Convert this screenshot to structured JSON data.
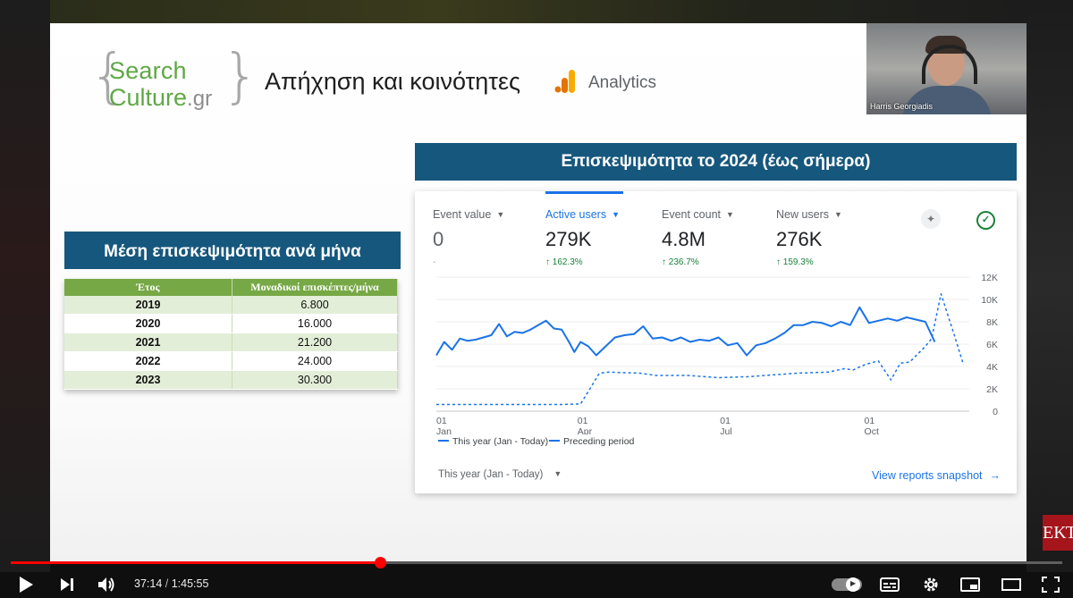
{
  "logo": {
    "line1": "Search",
    "line2": "Culture",
    "suffix": ".gr"
  },
  "slide": {
    "title": "Απήχηση και κοινότητες",
    "ga_label": "Analytics",
    "right_banner": "Επισκεψιμότητα το 2024 (έως σήμερα)",
    "left_banner": "Μέση επισκεψιμότητα ανά μήνα"
  },
  "webcam": {
    "name": "Harris Georgiadis"
  },
  "yearly_table": {
    "headers": [
      "Έτος",
      "Μοναδικοί επισκέπτες/μήνα"
    ],
    "rows": [
      {
        "year": "2019",
        "visitors": "6.800"
      },
      {
        "year": "2020",
        "visitors": "16.000"
      },
      {
        "year": "2021",
        "visitors": "21.200"
      },
      {
        "year": "2022",
        "visitors": "24.000"
      },
      {
        "year": "2023",
        "visitors": "30.300"
      }
    ]
  },
  "ga_card": {
    "metrics": [
      {
        "label": "Event value",
        "value": "0",
        "change": "-",
        "active": false
      },
      {
        "label": "Active users",
        "value": "279K",
        "change": "↑ 162.3%",
        "active": true
      },
      {
        "label": "Event count",
        "value": "4.8M",
        "change": "↑ 236.7%",
        "active": false
      },
      {
        "label": "New users",
        "value": "276K",
        "change": "↑ 159.3%",
        "active": false
      }
    ],
    "legend": {
      "current": "This year (Jan - Today)",
      "previous": "Preceding period"
    },
    "range_selector": "This year (Jan - Today)",
    "view_link": "View reports snapshot",
    "colors": {
      "accent": "#1a73e8",
      "positive": "#188038"
    }
  },
  "chart_data": {
    "type": "line",
    "y_ticks": [
      "12K",
      "10K",
      "8K",
      "6K",
      "4K",
      "2K",
      "0"
    ],
    "ylim": [
      0,
      12000
    ],
    "x_ticks": [
      {
        "label": "01 Jan",
        "day": 0
      },
      {
        "label": "01 Apr",
        "day": 90
      },
      {
        "label": "01 Jul",
        "day": 181
      },
      {
        "label": "01 Oct",
        "day": 273
      }
    ],
    "grid": true,
    "series": [
      {
        "name": "This year (Jan - Today)",
        "style": "solid",
        "color": "#1a73e8",
        "points": [
          [
            0,
            5000
          ],
          [
            5,
            6200
          ],
          [
            10,
            5500
          ],
          [
            15,
            6500
          ],
          [
            20,
            6300
          ],
          [
            25,
            6400
          ],
          [
            30,
            6600
          ],
          [
            35,
            6800
          ],
          [
            40,
            7800
          ],
          [
            45,
            6700
          ],
          [
            50,
            7100
          ],
          [
            55,
            7000
          ],
          [
            60,
            7300
          ],
          [
            65,
            7700
          ],
          [
            70,
            8100
          ],
          [
            75,
            7400
          ],
          [
            80,
            7300
          ],
          [
            85,
            6100
          ],
          [
            88,
            5300
          ],
          [
            92,
            6200
          ],
          [
            97,
            5800
          ],
          [
            102,
            5000
          ],
          [
            108,
            5800
          ],
          [
            114,
            6600
          ],
          [
            120,
            6800
          ],
          [
            126,
            6900
          ],
          [
            132,
            7600
          ],
          [
            138,
            6500
          ],
          [
            144,
            6600
          ],
          [
            150,
            6300
          ],
          [
            156,
            6600
          ],
          [
            162,
            6200
          ],
          [
            168,
            6400
          ],
          [
            174,
            6300
          ],
          [
            180,
            6600
          ],
          [
            186,
            5900
          ],
          [
            192,
            6100
          ],
          [
            198,
            5000
          ],
          [
            204,
            5900
          ],
          [
            210,
            6100
          ],
          [
            216,
            6500
          ],
          [
            222,
            7000
          ],
          [
            228,
            7700
          ],
          [
            234,
            7700
          ],
          [
            240,
            8000
          ],
          [
            246,
            7900
          ],
          [
            252,
            7600
          ],
          [
            258,
            8000
          ],
          [
            264,
            7700
          ],
          [
            270,
            9300
          ],
          [
            276,
            7900
          ],
          [
            282,
            8100
          ],
          [
            288,
            8300
          ],
          [
            294,
            8100
          ],
          [
            300,
            8400
          ],
          [
            306,
            8200
          ],
          [
            312,
            8000
          ],
          [
            318,
            6200
          ]
        ]
      },
      {
        "name": "Preceding period",
        "style": "dashed",
        "color": "#1a73e8",
        "points": [
          [
            0,
            600
          ],
          [
            20,
            600
          ],
          [
            40,
            600
          ],
          [
            60,
            600
          ],
          [
            80,
            600
          ],
          [
            92,
            650
          ],
          [
            98,
            2000
          ],
          [
            104,
            3400
          ],
          [
            110,
            3500
          ],
          [
            130,
            3400
          ],
          [
            140,
            3200
          ],
          [
            160,
            3200
          ],
          [
            180,
            3000
          ],
          [
            200,
            3100
          ],
          [
            210,
            3200
          ],
          [
            230,
            3400
          ],
          [
            250,
            3500
          ],
          [
            260,
            3800
          ],
          [
            266,
            3700
          ],
          [
            274,
            4200
          ],
          [
            282,
            4500
          ],
          [
            290,
            2800
          ],
          [
            296,
            4300
          ],
          [
            302,
            4400
          ],
          [
            312,
            5800
          ],
          [
            316,
            6500
          ],
          [
            322,
            10500
          ],
          [
            330,
            7000
          ],
          [
            336,
            4300
          ]
        ]
      }
    ]
  },
  "player": {
    "current_time": "37:14",
    "duration": "1:45:55",
    "progress": 0.3515,
    "watermark": "ΕΚΤ"
  }
}
